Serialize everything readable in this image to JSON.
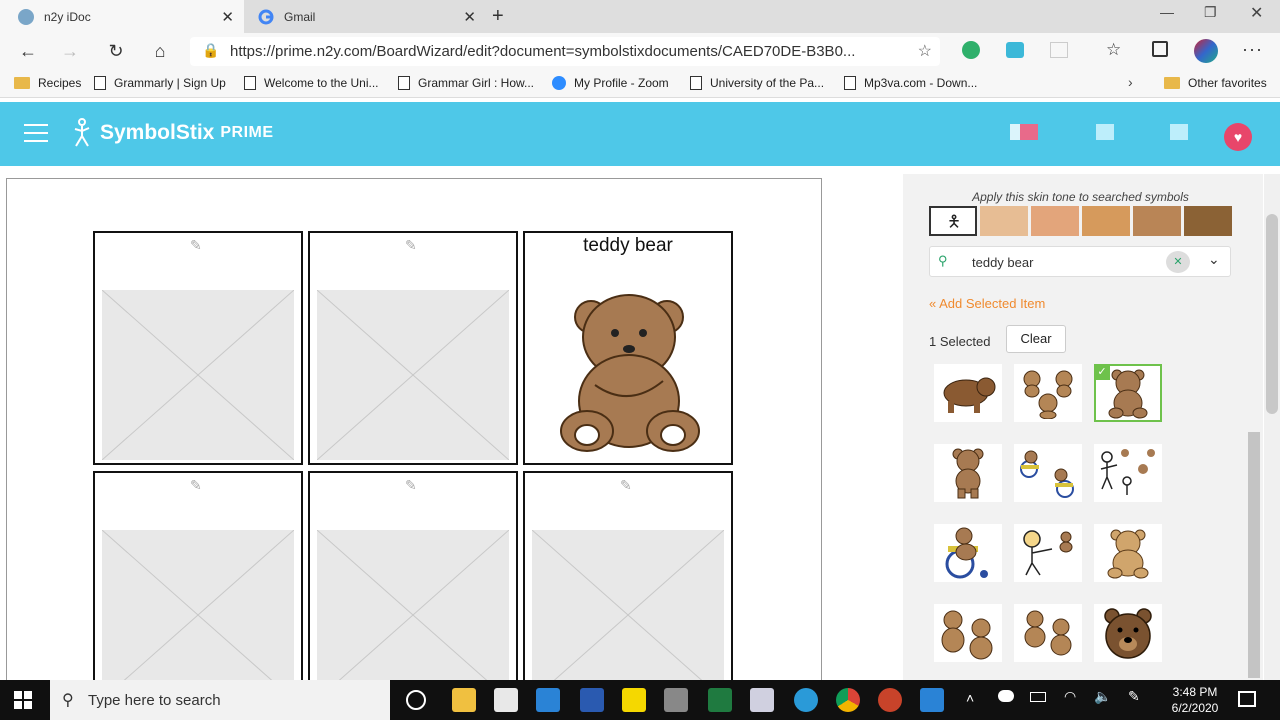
{
  "browser": {
    "tabs": [
      {
        "title": "n2y iDoc",
        "active": true
      },
      {
        "title": "Gmail",
        "active": false
      }
    ],
    "url": "https://prime.n2y.com/BoardWizard/edit?document=symbolstixdocuments/CAED70DE-B3B0...",
    "favorites": [
      {
        "label": "Recipes",
        "type": "folder"
      },
      {
        "label": "Grammarly | Sign Up",
        "type": "page"
      },
      {
        "label": "Welcome to the Uni...",
        "type": "page"
      },
      {
        "label": "Grammar Girl : How...",
        "type": "page"
      },
      {
        "label": "My Profile - Zoom",
        "type": "zoom"
      },
      {
        "label": "University of the Pa...",
        "type": "page"
      },
      {
        "label": "Mp3va.com - Down...",
        "type": "page"
      },
      {
        "label": "Other favorites",
        "type": "folder"
      }
    ]
  },
  "app": {
    "logo_text": "SymbolStix",
    "logo_suffix": "PRIME",
    "accent_color": "#4ec8e8"
  },
  "board": {
    "cells": [
      {
        "label": "",
        "has_symbol": false
      },
      {
        "label": "",
        "has_symbol": false
      },
      {
        "label": "teddy bear",
        "has_symbol": true
      },
      {
        "label": "",
        "has_symbol": false
      },
      {
        "label": "",
        "has_symbol": false
      },
      {
        "label": "",
        "has_symbol": false
      }
    ]
  },
  "panel": {
    "skin_tone_label": "Apply this skin tone to searched symbols",
    "skin_tones": [
      "#ffffff",
      "#e7bd94",
      "#e3a57b",
      "#d69a5c",
      "#b98556",
      "#8b6235"
    ],
    "search_value": "teddy bear",
    "add_selected": "« Add Selected Item",
    "selected_count": "1 Selected",
    "clear_label": "Clear",
    "results": [
      "brown-bear-icon",
      "three-bears-icon",
      "teddy-bear-icon",
      "teddy-bear-standing-icon",
      "bear-wheelchair-pair-icon",
      "person-throwing-bears-icon",
      "bear-in-wheelchair-icon",
      "person-reaching-bear-icon",
      "teddy-bear-sitting-icon",
      "two-bears-icon",
      "two-small-bears-icon",
      "bear-face-icon"
    ]
  },
  "taskbar": {
    "search_placeholder": "Type here to search",
    "time": "3:48 PM",
    "date": "6/2/2020"
  }
}
